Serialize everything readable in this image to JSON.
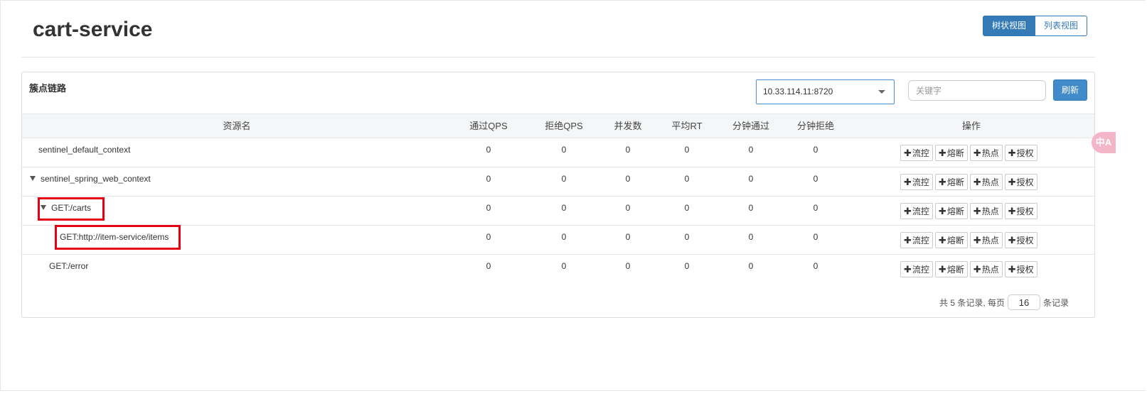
{
  "page": {
    "title": "cart-service"
  },
  "view_toggle": {
    "tree_view": "树状视图",
    "list_view": "列表视图"
  },
  "panel": {
    "title": "簇点链路",
    "machine_select": {
      "value": "10.33.114.11:8720"
    },
    "search": {
      "placeholder": "关键字",
      "value": ""
    },
    "refresh_label": "刷新"
  },
  "table": {
    "columns": [
      "资源名",
      "通过QPS",
      "拒绝QPS",
      "并发数",
      "平均RT",
      "分钟通过",
      "分钟拒绝",
      "操作"
    ],
    "rows": [
      {
        "name": "sentinel_default_context",
        "expandable": false,
        "values": [
          "0",
          "0",
          "0",
          "0",
          "0",
          "0"
        ]
      },
      {
        "name": "sentinel_spring_web_context",
        "expandable": true,
        "values": [
          "0",
          "0",
          "0",
          "0",
          "0",
          "0"
        ]
      },
      {
        "name": "GET:/carts",
        "expandable": true,
        "values": [
          "0",
          "0",
          "0",
          "0",
          "0",
          "0"
        ]
      },
      {
        "name": "GET:http://item-service/items",
        "expandable": false,
        "values": [
          "0",
          "0",
          "0",
          "0",
          "0",
          "0"
        ]
      },
      {
        "name": "GET:/error",
        "expandable": false,
        "values": [
          "0",
          "0",
          "0",
          "0",
          "0",
          "0"
        ]
      }
    ],
    "actions": [
      "流控",
      "熔断",
      "热点",
      "授权"
    ]
  },
  "pager": {
    "prefix": "共 5 条记录, 每页",
    "page_size": "16",
    "suffix": "条记录"
  },
  "translate_widget": {
    "label": "中A"
  },
  "colors": {
    "primary": "#337ab7",
    "highlight": "#e60012"
  }
}
